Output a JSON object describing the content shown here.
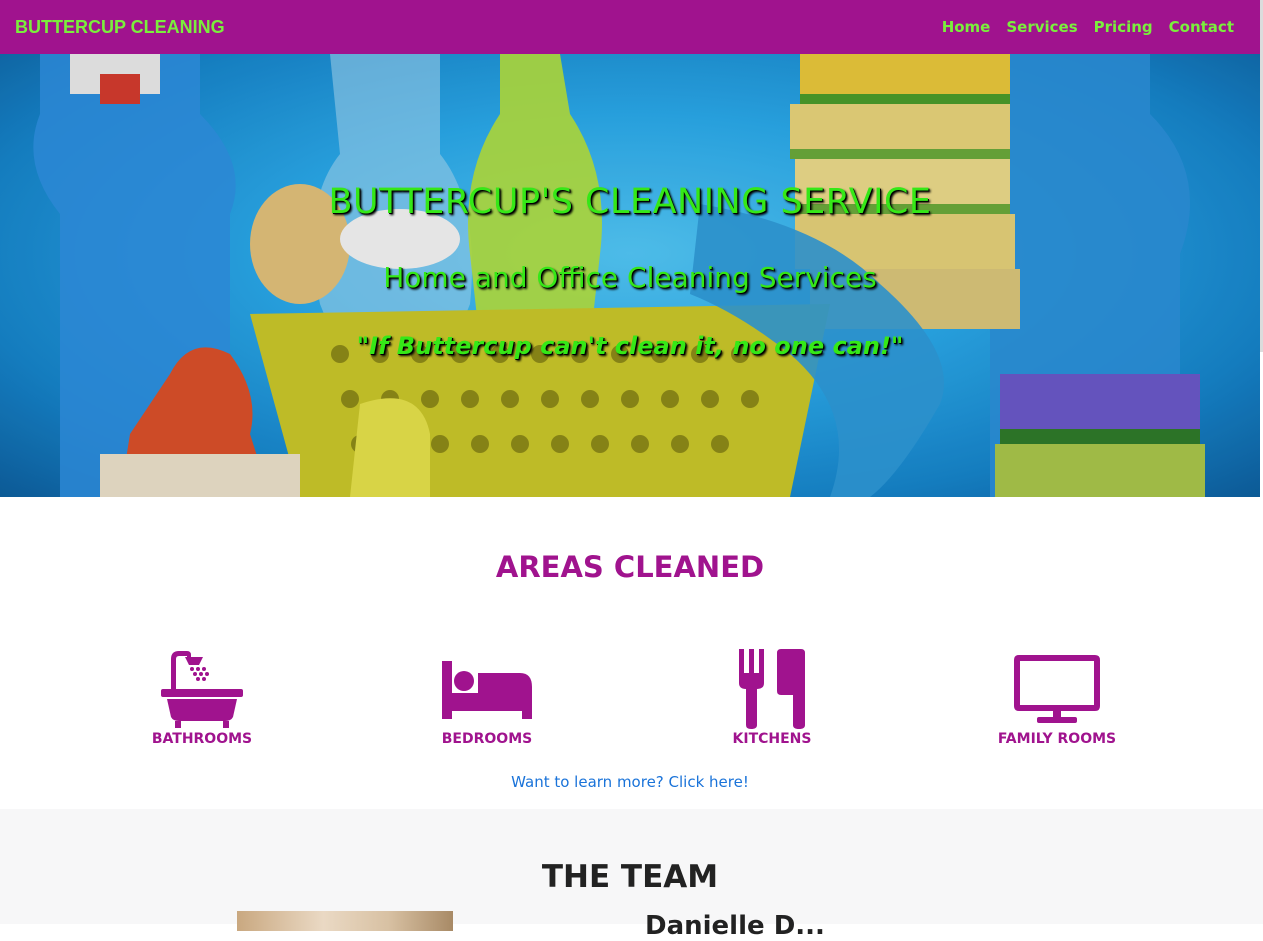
{
  "nav": {
    "brand": "BUTTERCUP CLEANING",
    "links": [
      "Home",
      "Services",
      "Pricing",
      "Contact"
    ]
  },
  "hero": {
    "title": "BUTTERCUP'S CLEANING SERVICE",
    "subtitle": "Home and Office Cleaning Services",
    "quote": "\"If Buttercup can't clean it, no one can!\""
  },
  "areas": {
    "title": "AREAS CLEANED",
    "items": [
      {
        "label": "BATHROOMS",
        "icon": "bath-shower-icon"
      },
      {
        "label": "BEDROOMS",
        "icon": "bed-icon"
      },
      {
        "label": "KITCHENS",
        "icon": "fork-knife-icon"
      },
      {
        "label": "FAMILY ROOMS",
        "icon": "tv-monitor-icon"
      }
    ],
    "learn_more": "Want to learn more? Click here!"
  },
  "team": {
    "title": "THE TEAM",
    "member_name": "Danielle D..."
  },
  "colors": {
    "primary": "#a0138e",
    "accent_green": "#7aef3c",
    "hero_text": "#35e817",
    "link": "#1a73d9"
  }
}
